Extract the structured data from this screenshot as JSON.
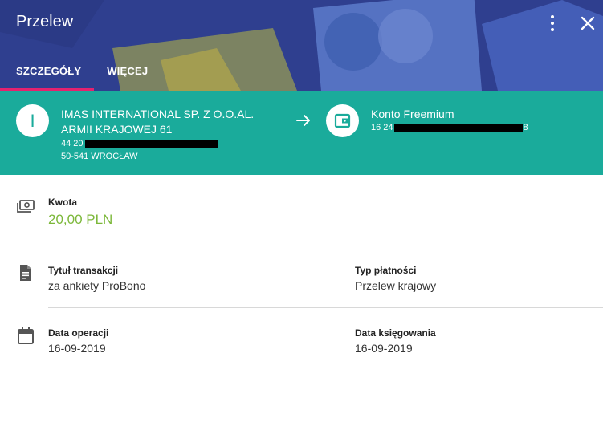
{
  "header": {
    "title": "Przelew",
    "tabs": [
      {
        "label": "SZCZEGÓŁY",
        "active": true
      },
      {
        "label": "WIĘCEJ",
        "active": false
      }
    ]
  },
  "transfer": {
    "from": {
      "initial": "I",
      "name": "IMAS INTERNATIONAL SP. Z O.O.AL. ARMII KRAJOWEJ 61",
      "account_prefix": "44 20",
      "address": "50-541 WROCŁAW"
    },
    "to": {
      "name": "Konto Freemium",
      "account_prefix": "16 24",
      "account_suffix": "8"
    }
  },
  "details": {
    "amount_label": "Kwota",
    "amount_value": "20,00 PLN",
    "title_label": "Tytuł transakcji",
    "title_value": "za ankiety ProBono",
    "payment_type_label": "Typ płatności",
    "payment_type_value": "Przelew krajowy",
    "operation_date_label": "Data operacji",
    "operation_date_value": "16-09-2019",
    "booking_date_label": "Data księgowania",
    "booking_date_value": "16-09-2019"
  },
  "colors": {
    "header_bg": "#2f3f8f",
    "banner_bg": "#1aab9b",
    "tab_indicator": "#e5226f",
    "amount": "#7cb83a"
  },
  "icons": {
    "menu": "more-vert-icon",
    "close": "close-icon",
    "arrow": "arrow-right-icon",
    "account": "wallet-icon",
    "amount": "money-icon",
    "title": "document-icon",
    "date": "calendar-icon"
  }
}
